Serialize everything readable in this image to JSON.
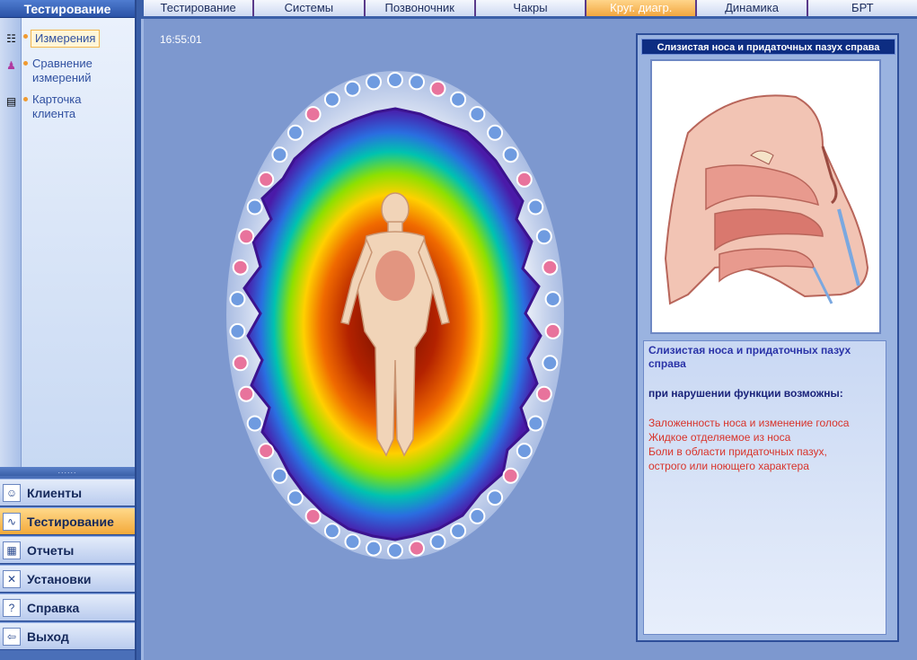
{
  "sidebar": {
    "title": "Тестирование",
    "items": [
      {
        "label": "Измерения",
        "icon": "list-icon"
      },
      {
        "label": "Сравнение измерений",
        "icon": "compare-icon"
      },
      {
        "label": "Карточка клиента",
        "icon": "card-icon"
      }
    ],
    "grip": "......"
  },
  "nav": [
    {
      "label": "Клиенты",
      "icon": "clients-icon",
      "active": false
    },
    {
      "label": "Тестирование",
      "icon": "testing-icon",
      "active": true
    },
    {
      "label": "Отчеты",
      "icon": "reports-icon",
      "active": false
    },
    {
      "label": "Установки",
      "icon": "settings-icon",
      "active": false
    },
    {
      "label": "Справка",
      "icon": "help-icon",
      "active": false
    },
    {
      "label": "Выход",
      "icon": "exit-icon",
      "active": false
    }
  ],
  "tabs": [
    {
      "label": "Тестирование",
      "active": false
    },
    {
      "label": "Системы",
      "active": false
    },
    {
      "label": "Позвоночник",
      "active": false
    },
    {
      "label": "Чакры",
      "active": false
    },
    {
      "label": "Круг. диагр.",
      "active": true
    },
    {
      "label": "Динамика",
      "active": false
    },
    {
      "label": "БРТ",
      "active": false
    }
  ],
  "main": {
    "timestamp": "16:55:01",
    "aura": {
      "total_points": 46,
      "pink_color": "#e8739c",
      "blue_color": "#6f9be0"
    }
  },
  "info": {
    "title": "Слизистая носа и придаточных пазух справа",
    "desc_title": "Слизистая носа и придаточных пазух справа",
    "subtitle": "при нарушении функции возможны:",
    "symptoms": [
      "Заложенность носа и изменение голоса",
      "Жидкое отделяемое из носа",
      "Боли в области придаточных пазух,",
      "острого или ноющего характера"
    ]
  },
  "colors": {
    "accent": "#f2a640",
    "title_bar": "#0d2d82",
    "symptom_text": "#d8332a"
  }
}
